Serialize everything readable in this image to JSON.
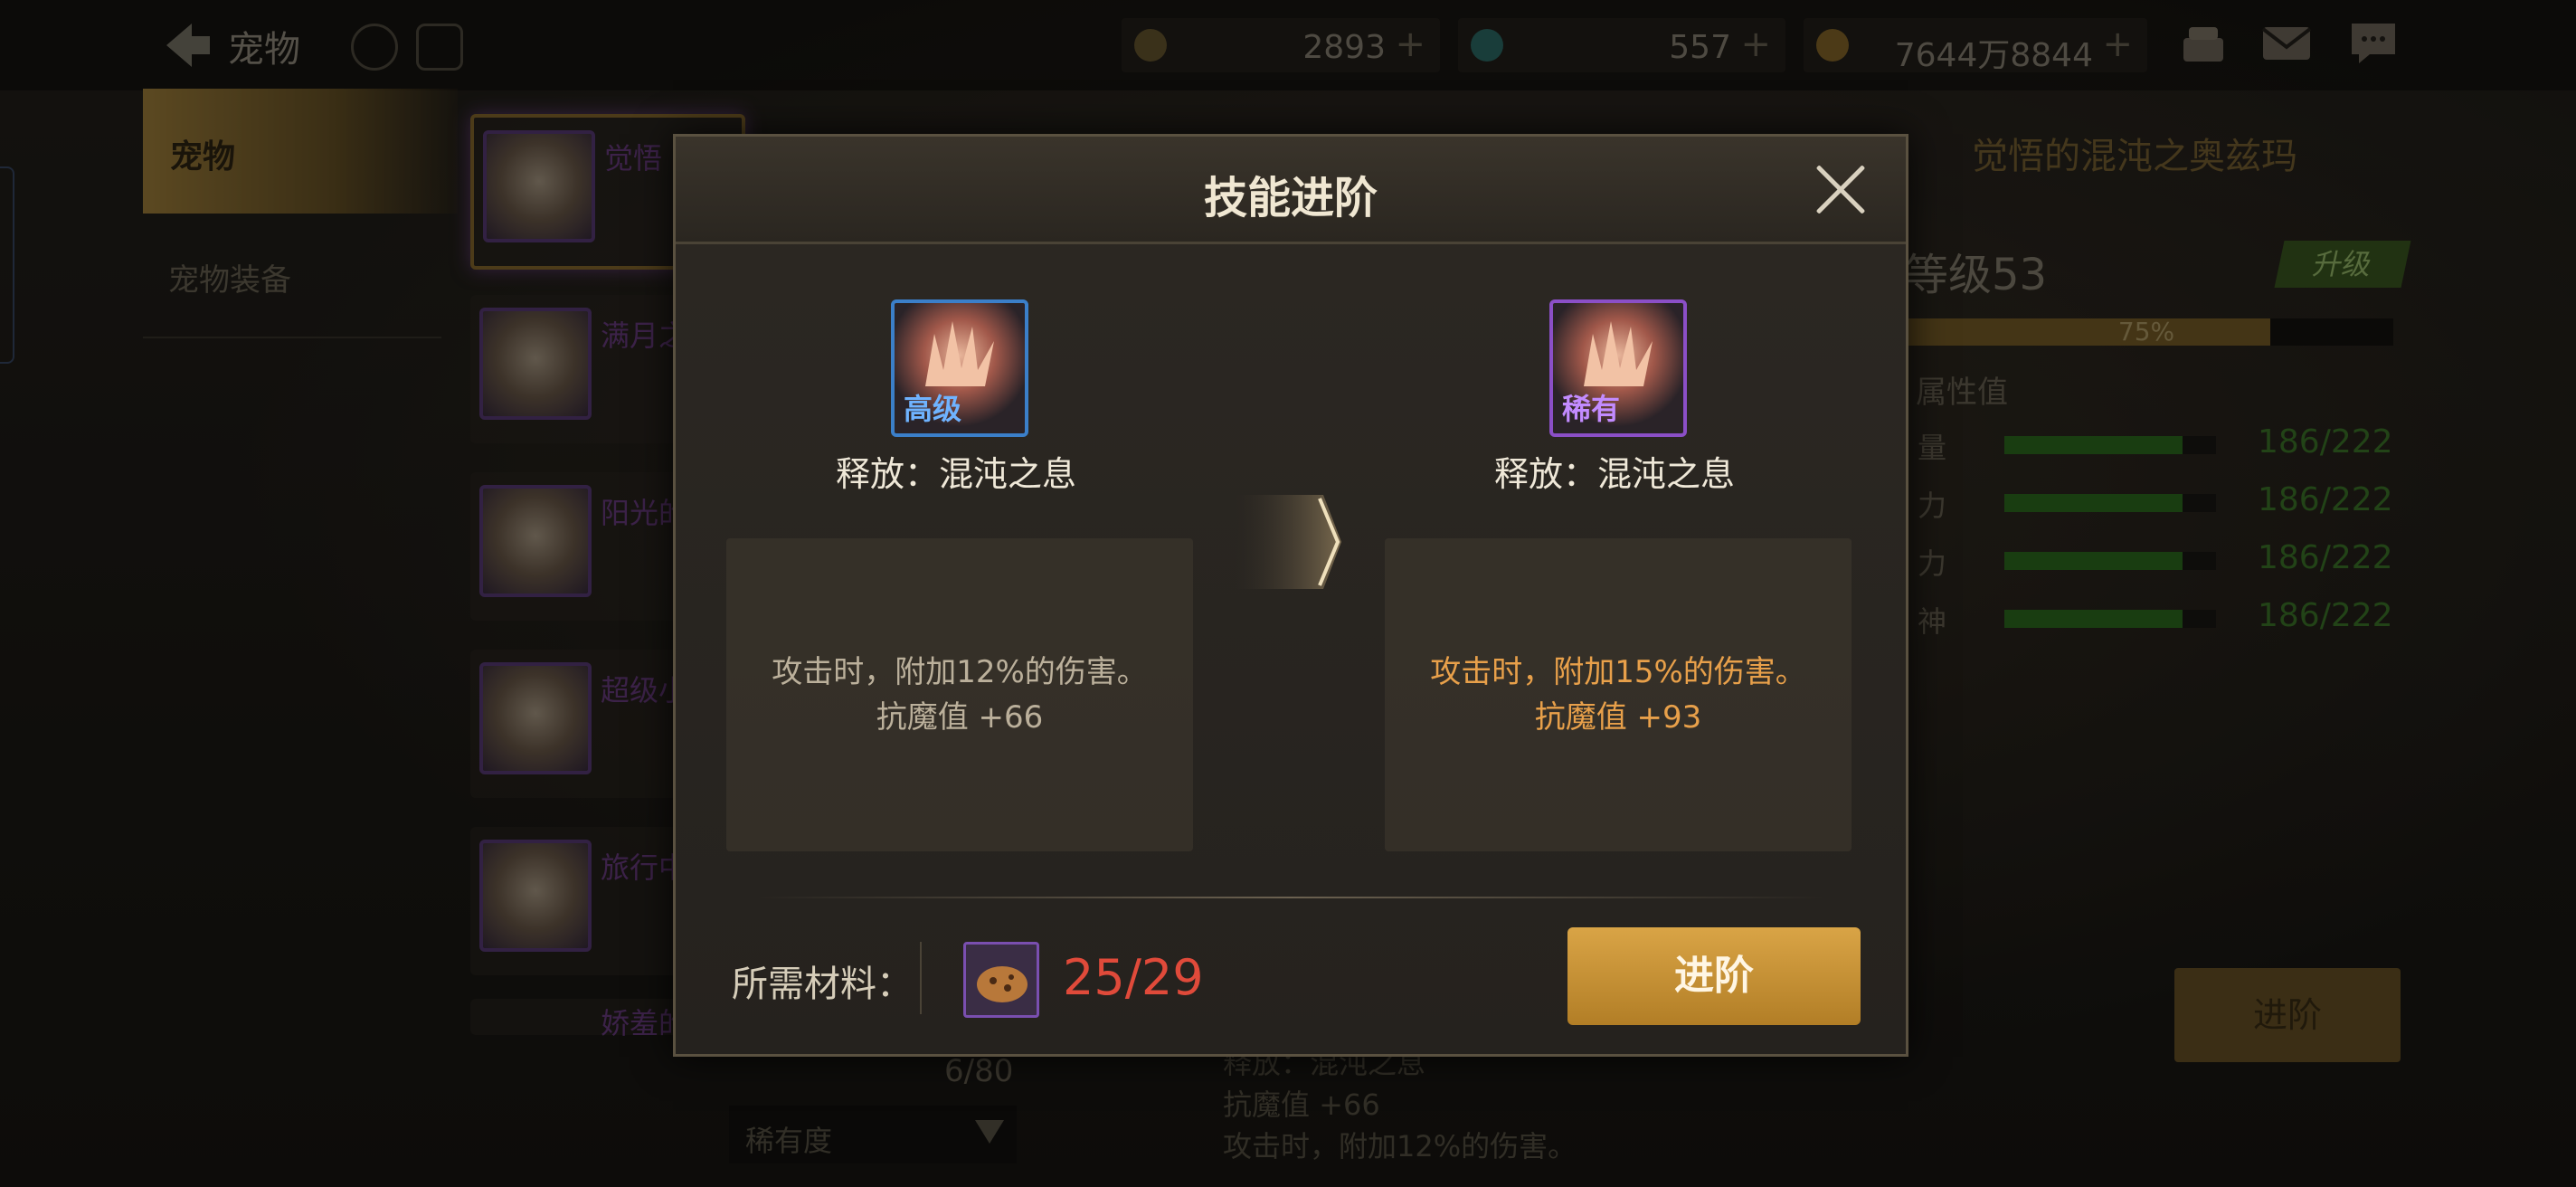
{
  "header": {
    "title": "宠物",
    "resources": [
      {
        "name": "moon-currency",
        "value": "2893"
      },
      {
        "name": "crystal-currency",
        "value": "557"
      },
      {
        "name": "gold-currency",
        "value": "7644万8844"
      }
    ]
  },
  "sidebar": {
    "items": [
      {
        "label": "宠物",
        "active": true
      },
      {
        "label": "宠物装备",
        "active": false
      }
    ]
  },
  "pet_list": {
    "items": [
      {
        "name": "觉悟"
      },
      {
        "name": "满月之"
      },
      {
        "name": "阳光的"
      },
      {
        "name": "超级小"
      },
      {
        "name": "旅行中"
      },
      {
        "name": "娇羞的"
      }
    ],
    "count": "6/80",
    "filter": "稀有度"
  },
  "pet_info": {
    "name": "觉悟的混沌之奥兹玛",
    "level": "等级53",
    "upgrade": "升级",
    "exp_percent": "75%",
    "exp_fraction": 0.75,
    "attr_header": "属性值",
    "attributes": [
      {
        "label": "量",
        "value": "186/222",
        "fraction": 0.84
      },
      {
        "label": "力",
        "value": "186/222",
        "fraction": 0.84
      },
      {
        "label": "力",
        "value": "186/222",
        "fraction": 0.84
      },
      {
        "label": "神",
        "value": "186/222",
        "fraction": 0.84
      }
    ],
    "advance": "进阶"
  },
  "background_skill": {
    "lines": [
      "释放：混沌之息",
      "抗魔值 +66",
      "攻击时，附加12%的伤害。"
    ]
  },
  "modal": {
    "title": "技能进阶",
    "current": {
      "grade": "高级",
      "name": "释放：混沌之息",
      "desc_line1": "攻击时，附加12%的伤害。",
      "desc_line2": "抗魔值 +66"
    },
    "next": {
      "grade": "稀有",
      "name": "释放：混沌之息",
      "desc_line1": "攻击时，附加15%的伤害。",
      "desc_line2": "抗魔值 +93"
    },
    "material_label": "所需材料：",
    "material_count": "25/29",
    "advance_button": "进阶"
  },
  "colors": {
    "gold_button": "#c9913a",
    "insufficient": "#e04a3a",
    "new_stat": "#e8a04a",
    "grade_high": "#3b7fc9",
    "grade_rare": "#8b4fc7"
  }
}
